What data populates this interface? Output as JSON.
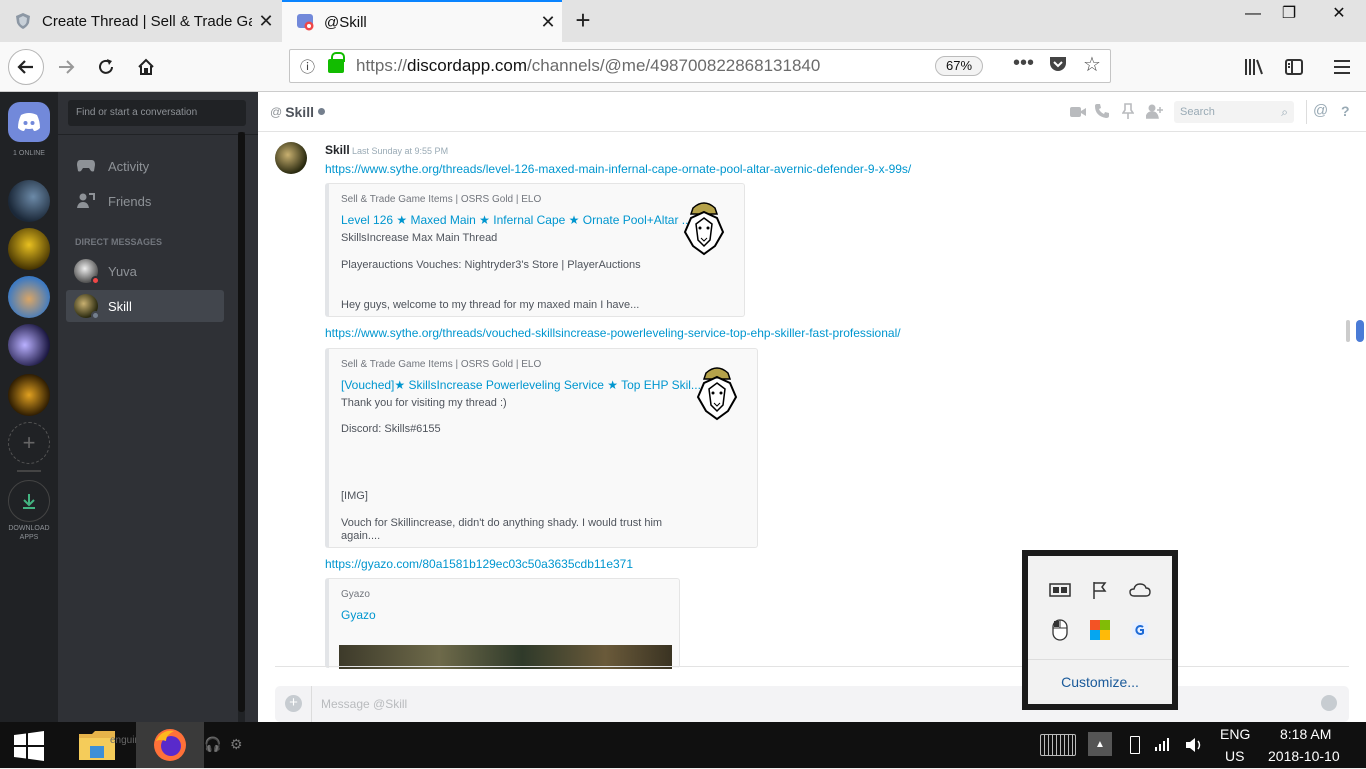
{
  "browser": {
    "tabs": [
      {
        "title": "Create Thread | Sell & Trade Ga",
        "active": false
      },
      {
        "title": "@Skill",
        "active": true
      }
    ],
    "url_prefix": "https://",
    "url_host": "discordapp.com",
    "url_path": "/channels/@me/498700822868131840",
    "zoom": "67%"
  },
  "discord": {
    "online_count": "1 ONLINE",
    "download_apps": "DOWNLOAD APPS",
    "search_placeholder": "Find or start a conversation",
    "nav": [
      {
        "label": "Activity",
        "icon": "gamepad-icon"
      },
      {
        "label": "Friends",
        "icon": "friends-icon"
      }
    ],
    "dm_header": "DIRECT MESSAGES",
    "dms": [
      {
        "name": "Yuva",
        "status": "dnd"
      },
      {
        "name": "Skill",
        "status": "offline",
        "selected": true
      }
    ],
    "channel": {
      "at": "@",
      "name": "Skill",
      "search_placeholder": "Search"
    },
    "message": {
      "author": "Skill",
      "timestamp": "Last Sunday at 9:55 PM",
      "links": [
        "https://www.sythe.org/threads/level-126-maxed-main-infernal-cape-ornate-pool-altar-avernic-defender-9-x-99s/",
        "https://www.sythe.org/threads/vouched-skillsincrease-powerleveling-service-top-ehp-skiller-fast-professional/",
        "https://gyazo.com/80a1581b129ec03c50a3635cdb11e371"
      ]
    },
    "embeds": [
      {
        "provider": "Sell & Trade Game Items | OSRS Gold | ELO",
        "title": "Level 126 ★ Maxed Main ★ Infernal Cape ★ Ornate Pool+Altar ...",
        "lines": [
          "SkillsIncrease Max Main Thread",
          "",
          "Playerauctions Vouches: Nightryder3's Store | PlayerAuctions",
          "",
          "",
          "Hey guys, welcome to my thread for my maxed main I have..."
        ]
      },
      {
        "provider": "Sell & Trade Game Items | OSRS Gold | ELO",
        "title": "[Vouched]★ SkillsIncrease Powerleveling Service ★ Top EHP Skil...",
        "lines": [
          "Thank you for visiting my thread :)",
          "",
          "Discord: Skills#6155",
          "",
          "",
          "",
          "",
          "[IMG]",
          "",
          "Vouch for Skillincrease, didn't do anything shady. I would trust him",
          "again...."
        ]
      },
      {
        "provider": "Gyazo",
        "title": "Gyazo"
      }
    ],
    "composer_placeholder": "Message @Skill",
    "user_name_partial": "enguin"
  },
  "tray_popup": {
    "customize_label": "Customize..."
  },
  "taskbar": {
    "lang_top": "ENG",
    "lang_bottom": "US",
    "time": "8:18 AM",
    "date": "2018-10-10"
  },
  "colors": {
    "discord_blurple": "#7289da",
    "link": "#0096cf",
    "firefox_accent": "#0a84ff",
    "secure_green": "#12bc00"
  }
}
